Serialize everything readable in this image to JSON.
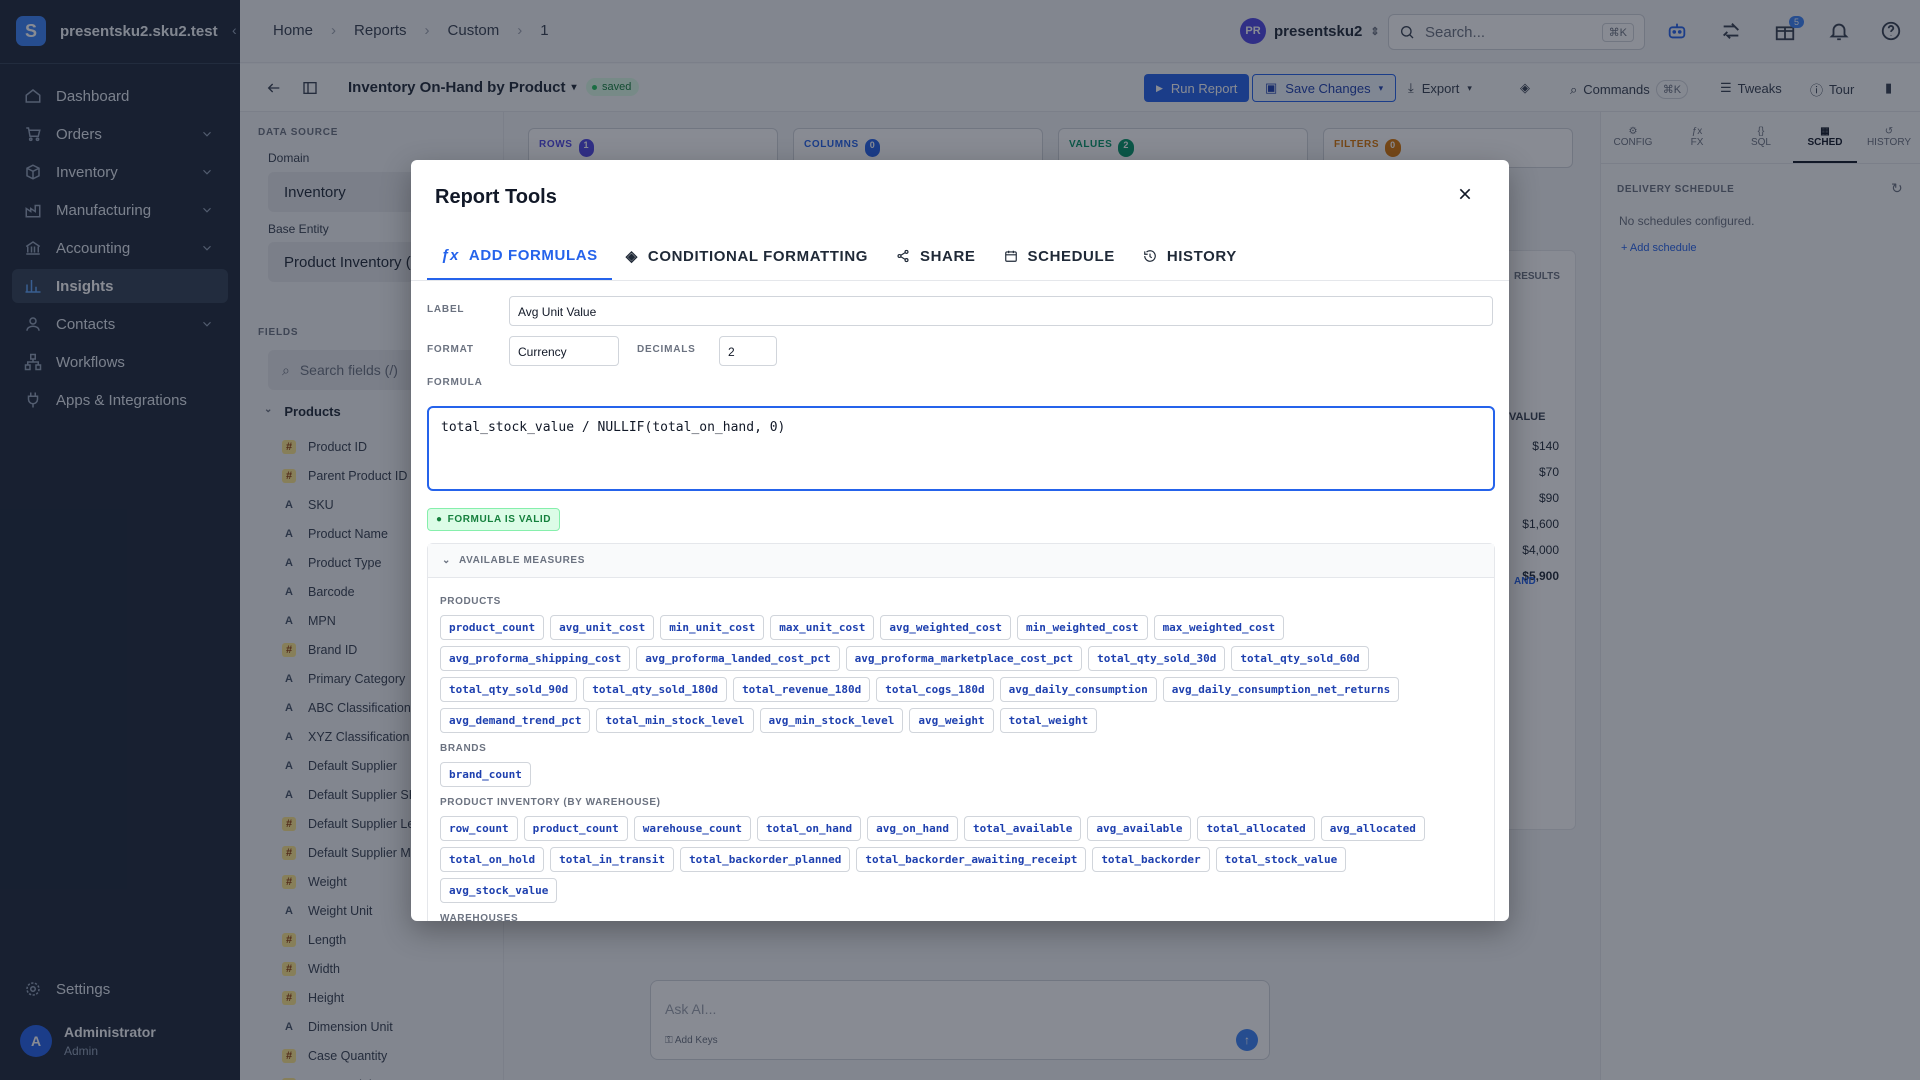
{
  "sidebar": {
    "brand": "presentsku2.sku2.test",
    "items": [
      {
        "label": "Dashboard",
        "icon": "home-icon"
      },
      {
        "label": "Orders",
        "icon": "cart-icon"
      },
      {
        "label": "Inventory",
        "icon": "box-icon"
      },
      {
        "label": "Manufacturing",
        "icon": "factory-icon"
      },
      {
        "label": "Accounting",
        "icon": "bank-icon"
      },
      {
        "label": "Insights",
        "icon": "chart-icon"
      },
      {
        "label": "Contacts",
        "icon": "user-icon"
      },
      {
        "label": "Workflows",
        "icon": "workflow-icon"
      },
      {
        "label": "Apps & Integrations",
        "icon": "plug-icon"
      }
    ],
    "settings": "Settings",
    "user_name": "Administrator",
    "user_role": "Admin",
    "user_initial": "A"
  },
  "topbar": {
    "crumbs": [
      "Home",
      "Reports",
      "Custom",
      "1"
    ],
    "project": "presentsku2",
    "project_initials": "PR",
    "search_placeholder": "Search...",
    "search_kbd": "⌘K",
    "gift_badge": "5"
  },
  "toolbar": {
    "report_title": "Inventory On-Hand by Product",
    "status": "saved",
    "run": "Run Report",
    "save": "Save Changes",
    "export": "Export",
    "commands": "Commands",
    "commands_kbd": "⌘K",
    "tweaks": "Tweaks",
    "tour": "Tour"
  },
  "datasource": {
    "section": "DATA SOURCE",
    "domain_label": "Domain",
    "domain_value": "Inventory",
    "entity_label": "Base Entity",
    "entity_value": "Product Inventory (b",
    "fields_section": "FIELDS",
    "fields_placeholder": "Search fields (/)",
    "group": "Products",
    "fields": [
      {
        "t": "#",
        "name": "Product ID"
      },
      {
        "t": "#",
        "name": "Parent Product ID"
      },
      {
        "t": "A",
        "name": "SKU"
      },
      {
        "t": "A",
        "name": "Product Name"
      },
      {
        "t": "A",
        "name": "Product Type"
      },
      {
        "t": "A",
        "name": "Barcode"
      },
      {
        "t": "A",
        "name": "MPN"
      },
      {
        "t": "#",
        "name": "Brand ID"
      },
      {
        "t": "A",
        "name": "Primary Category"
      },
      {
        "t": "A",
        "name": "ABC Classification"
      },
      {
        "t": "A",
        "name": "XYZ Classification"
      },
      {
        "t": "A",
        "name": "Default Supplier"
      },
      {
        "t": "A",
        "name": "Default Supplier SKU"
      },
      {
        "t": "#",
        "name": "Default Supplier Lea"
      },
      {
        "t": "#",
        "name": "Default Supplier MO"
      },
      {
        "t": "#",
        "name": "Weight"
      },
      {
        "t": "A",
        "name": "Weight Unit"
      },
      {
        "t": "#",
        "name": "Length"
      },
      {
        "t": "#",
        "name": "Width"
      },
      {
        "t": "#",
        "name": "Height"
      },
      {
        "t": "A",
        "name": "Dimension Unit"
      },
      {
        "t": "#",
        "name": "Case Quantity"
      },
      {
        "t": "#",
        "name": "Case Weight"
      }
    ]
  },
  "pills": [
    {
      "label": "ROWS",
      "count": "1",
      "color": "#4f46e5"
    },
    {
      "label": "COLUMNS",
      "count": "0",
      "color": "#2563eb"
    },
    {
      "label": "VALUES",
      "count": "2",
      "color": "#059669"
    },
    {
      "label": "FILTERS",
      "count": "0",
      "color": "#d97706"
    }
  ],
  "background": {
    "results_tab": "RESULTS",
    "value_header": "VALUE",
    "values": [
      "$140",
      "$70",
      "$90",
      "$1,600",
      "$4,000"
    ],
    "total": "$5,900",
    "and_chip": "AND",
    "ask_placeholder": "Ask AI...",
    "add_keys": "Add Keys"
  },
  "right": {
    "tabs": [
      "CONFIG",
      "FX",
      "SQL",
      "SCHED",
      "HISTORY"
    ],
    "delivery": "DELIVERY SCHEDULE",
    "none": "No schedules configured.",
    "add": "Add schedule"
  },
  "modal": {
    "title": "Report Tools",
    "tabs": [
      "ADD FORMULAS",
      "CONDITIONAL FORMATTING",
      "SHARE",
      "SCHEDULE",
      "HISTORY"
    ],
    "label_label": "LABEL",
    "label_value": "Avg Unit Value",
    "format_label": "FORMAT",
    "format_value": "Currency",
    "decimals_label": "DECIMALS",
    "decimals_value": "2",
    "formula_label": "FORMULA",
    "formula": "total_stock_value / NULLIF(total_on_hand, 0)",
    "valid": "FORMULA IS VALID",
    "measures_header": "AVAILABLE MEASURES",
    "groups": [
      {
        "name": "PRODUCTS",
        "chips": [
          "product_count",
          "avg_unit_cost",
          "min_unit_cost",
          "max_unit_cost",
          "avg_weighted_cost",
          "min_weighted_cost",
          "max_weighted_cost",
          "avg_proforma_shipping_cost",
          "avg_proforma_landed_cost_pct",
          "avg_proforma_marketplace_cost_pct",
          "total_qty_sold_30d",
          "total_qty_sold_60d",
          "total_qty_sold_90d",
          "total_qty_sold_180d",
          "total_revenue_180d",
          "total_cogs_180d",
          "avg_daily_consumption",
          "avg_daily_consumption_net_returns",
          "avg_demand_trend_pct",
          "total_min_stock_level",
          "avg_min_stock_level",
          "avg_weight",
          "total_weight"
        ]
      },
      {
        "name": "BRANDS",
        "chips": [
          "brand_count"
        ]
      },
      {
        "name": "PRODUCT INVENTORY (BY WAREHOUSE)",
        "chips": [
          "row_count",
          "product_count",
          "warehouse_count",
          "total_on_hand",
          "avg_on_hand",
          "total_available",
          "avg_available",
          "total_allocated",
          "avg_allocated",
          "total_on_hold",
          "total_in_transit",
          "total_backorder_planned",
          "total_backorder_awaiting_receipt",
          "total_backorder",
          "total_stock_value",
          "avg_stock_value"
        ]
      },
      {
        "name": "WAREHOUSES",
        "chips": []
      }
    ]
  }
}
